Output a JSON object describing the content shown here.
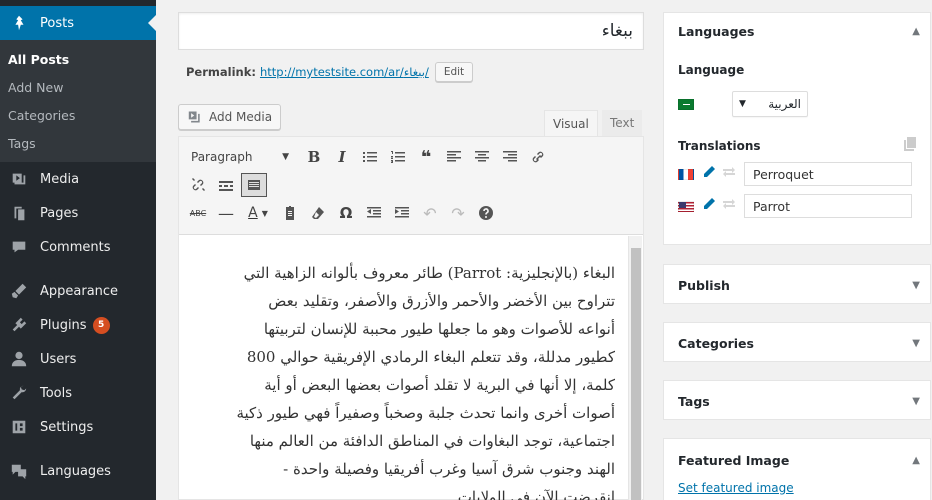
{
  "sidebar": {
    "posts": "Posts",
    "submenu": [
      "All Posts",
      "Add New",
      "Categories",
      "Tags"
    ],
    "items": [
      {
        "label": "Media",
        "icon": "media-icon"
      },
      {
        "label": "Pages",
        "icon": "pages-icon"
      },
      {
        "label": "Comments",
        "icon": "comments-icon"
      },
      {
        "label": "Appearance",
        "icon": "appearance-icon"
      },
      {
        "label": "Plugins",
        "icon": "plugins-icon",
        "badge": "5"
      },
      {
        "label": "Users",
        "icon": "users-icon"
      },
      {
        "label": "Tools",
        "icon": "tools-icon"
      },
      {
        "label": "Settings",
        "icon": "settings-icon"
      },
      {
        "label": "Languages",
        "icon": "languages-icon"
      }
    ]
  },
  "editor": {
    "title": "ببغاء",
    "permalink_label": "Permalink:",
    "permalink_url": "http://mytestsite.com/ar/ببغاء/",
    "edit_label": "Edit",
    "add_media": "Add Media",
    "tab_visual": "Visual",
    "tab_text": "Text",
    "format_select": "Paragraph",
    "content": "البغاء (بالإنجليزية: Parrot) طائر معروف بألوانه الزاهية التي تتراوح بين الأخضر والأحمر والأزرق والأصفر، وتقليد بعض أنواعه للأصوات وهو ما جعلها طيور محببة للإنسان لتربيتها كطيور مدللة، وقد تتعلم البغاء الرمادي الإفريقية حوالي 800 كلمة، إلا أنها في البرية لا تقلد أصوات بعضها البعض أو أية أصوات أخرى وانما تحدث جلبة وصخباً وصفيراً فهي طيور ذكية اجتماعية، توجد البغاوات في المناطق الدافئة من العالم منها الهند وجنوب شرق آسيا وغرب أفريقيا وفصيلة واحدة - انقرضت الآن في الولايات"
  },
  "languages_box": {
    "title": "Languages",
    "language_label": "Language",
    "selected_language": "العربية",
    "translations_label": "Translations",
    "translations": [
      {
        "flag": "fr",
        "value": "Perroquet"
      },
      {
        "flag": "us",
        "value": "Parrot"
      }
    ]
  },
  "boxes": {
    "publish": "Publish",
    "categories": "Categories",
    "tags": "Tags",
    "featured_image": "Featured Image",
    "set_featured": "Set featured image"
  }
}
